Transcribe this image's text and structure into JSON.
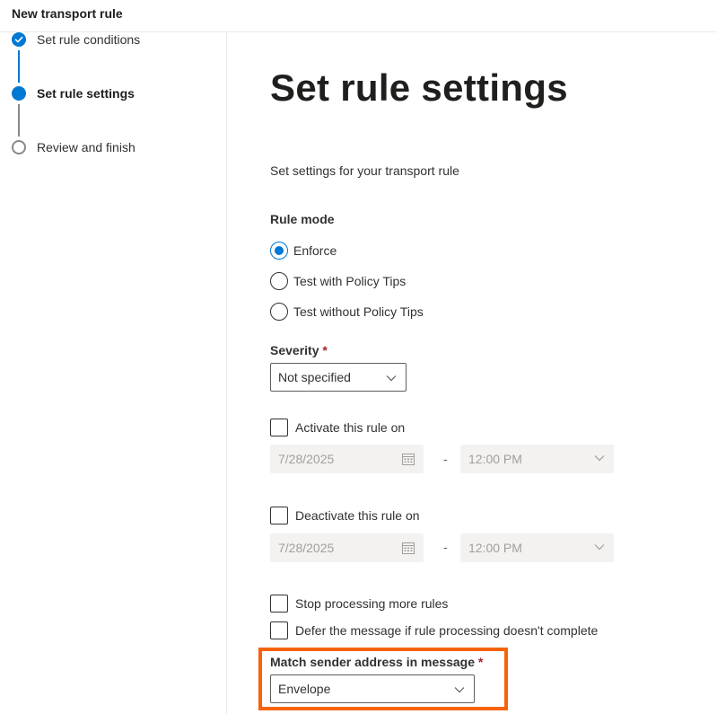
{
  "header": {
    "title": "New transport rule"
  },
  "steps": [
    {
      "label": "Set rule conditions",
      "state": "completed"
    },
    {
      "label": "Set rule settings",
      "state": "current"
    },
    {
      "label": "Review and finish",
      "state": "pending"
    }
  ],
  "main": {
    "title": "Set rule settings",
    "subtitle": "Set settings for your transport rule",
    "rule_mode": {
      "label": "Rule mode",
      "options": [
        "Enforce",
        "Test with Policy Tips",
        "Test without Policy Tips"
      ],
      "selected": "Enforce"
    },
    "severity": {
      "label": "Severity",
      "required_mark": "*",
      "value": "Not specified"
    },
    "activate": {
      "label": "Activate this rule on",
      "checked": false,
      "date": "7/28/2025",
      "separator": "-",
      "time": "12:00 PM"
    },
    "deactivate": {
      "label": "Deactivate this rule on",
      "checked": false,
      "date": "7/28/2025",
      "separator": "-",
      "time": "12:00 PM"
    },
    "stop_processing": {
      "label": "Stop processing more rules",
      "checked": false
    },
    "defer": {
      "label": "Defer the message if rule processing doesn't complete",
      "checked": false
    },
    "match_sender": {
      "label": "Match sender address in message",
      "required_mark": "*",
      "value": "Envelope"
    }
  },
  "colors": {
    "accent": "#0078d4",
    "highlight": "#f7630c",
    "required": "#a4262c"
  },
  "icons": [
    "checkmark-icon",
    "chevron-down-icon",
    "calendar-icon"
  ]
}
